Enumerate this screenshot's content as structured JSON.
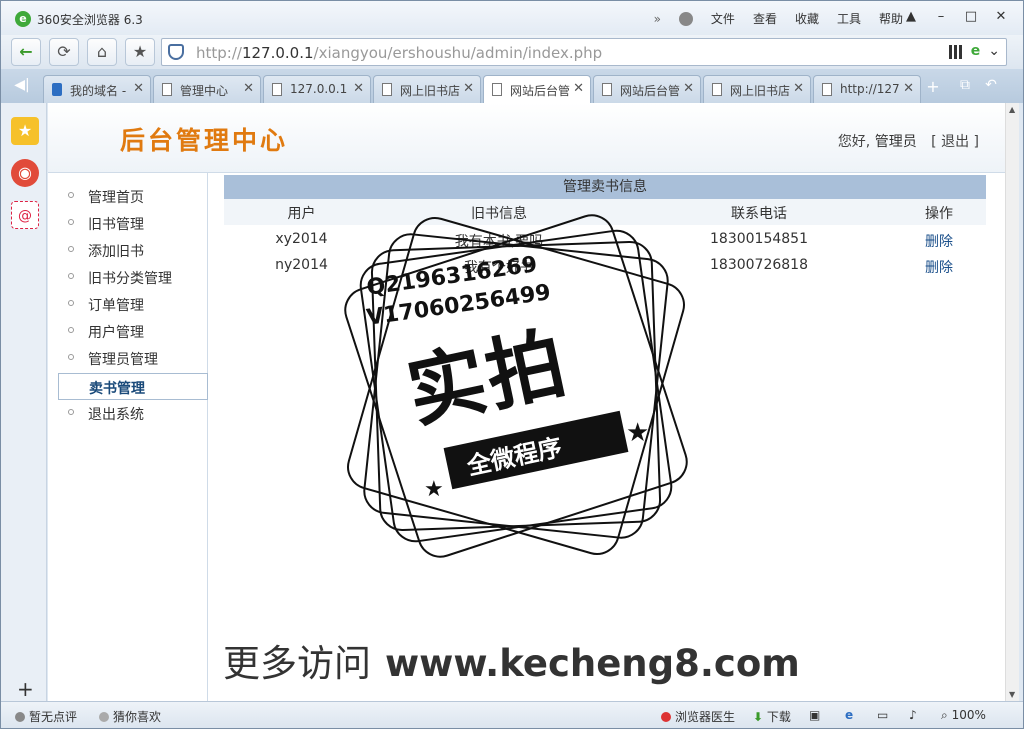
{
  "browser": {
    "title": "360安全浏览器 6.3",
    "menu": [
      "文件",
      "查看",
      "收藏",
      "工具",
      "帮助"
    ],
    "url_prefix": "http://",
    "url_host": "127.0.0.1",
    "url_path": "/xiangyou/ershoushu/admin/index.php",
    "tabs": [
      {
        "label": "我的域名 -"
      },
      {
        "label": "管理中心"
      },
      {
        "label": "127.0.0.1"
      },
      {
        "label": "网上旧书店"
      },
      {
        "label": "网站后台管"
      },
      {
        "label": "网站后台管"
      },
      {
        "label": "网上旧书店"
      },
      {
        "label": "http://127"
      }
    ]
  },
  "page": {
    "site_title": "后台管理中心",
    "greeting": "您好,",
    "user": "管理员",
    "logout": "[ 退出 ]",
    "menu": [
      {
        "label": "管理首页"
      },
      {
        "label": "旧书管理"
      },
      {
        "label": "添加旧书"
      },
      {
        "label": "旧书分类管理"
      },
      {
        "label": "订单管理"
      },
      {
        "label": "用户管理"
      },
      {
        "label": "管理员管理"
      },
      {
        "label": "卖书管理"
      },
      {
        "label": "退出系统"
      }
    ],
    "table_title": "管理卖书信息",
    "columns": [
      "用户",
      "旧书信息",
      "联系电话",
      "操作"
    ],
    "rows": [
      {
        "user": "xy2014",
        "info": "我有本书,要吗",
        "phone": "18300154851",
        "action": "删除"
      },
      {
        "user": "ny2014",
        "info": "我有个好书",
        "phone": "18300726818",
        "action": "删除"
      }
    ]
  },
  "watermark": {
    "qq": "Q2196316269",
    "vx": "V17060256499",
    "big": "实拍",
    "band": "全微程序",
    "footer_prefix": "更多访问",
    "footer_site": "www.kecheng8.com"
  },
  "status": {
    "left1": "暂无点评",
    "left2": "猜你喜欢",
    "doctor": "浏览器医生",
    "download": "下载",
    "zoom": "100%"
  }
}
